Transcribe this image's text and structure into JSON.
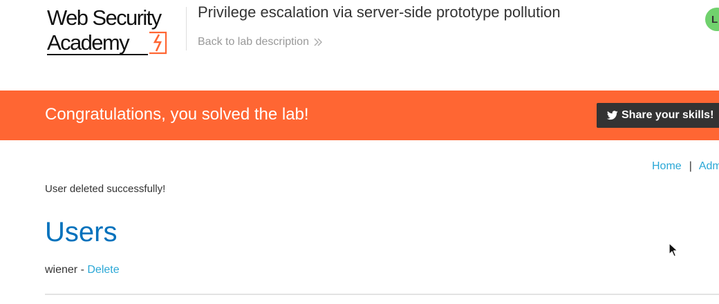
{
  "header": {
    "logo": {
      "line1": "Web Security",
      "line2": "Academy"
    },
    "lab_title": "Privilege escalation via server-side prototype pollution",
    "back_link": "Back to lab description",
    "avatar_initials": "L"
  },
  "banner": {
    "message": "Congratulations, you solved the lab!",
    "share_label": "Share your skills!",
    "color": "#ff6633"
  },
  "nav": {
    "home": "Home",
    "separator": "|",
    "admin": "Admin"
  },
  "main": {
    "status_message": "User deleted successfully!",
    "section_title": "Users",
    "users": [
      {
        "name": "wiener",
        "separator": "-",
        "action": "Delete"
      }
    ]
  },
  "colors": {
    "accent_orange": "#ff6633",
    "link_blue": "#29a7d6",
    "heading_blue": "#0071bc",
    "avatar_green": "#70d16d"
  }
}
